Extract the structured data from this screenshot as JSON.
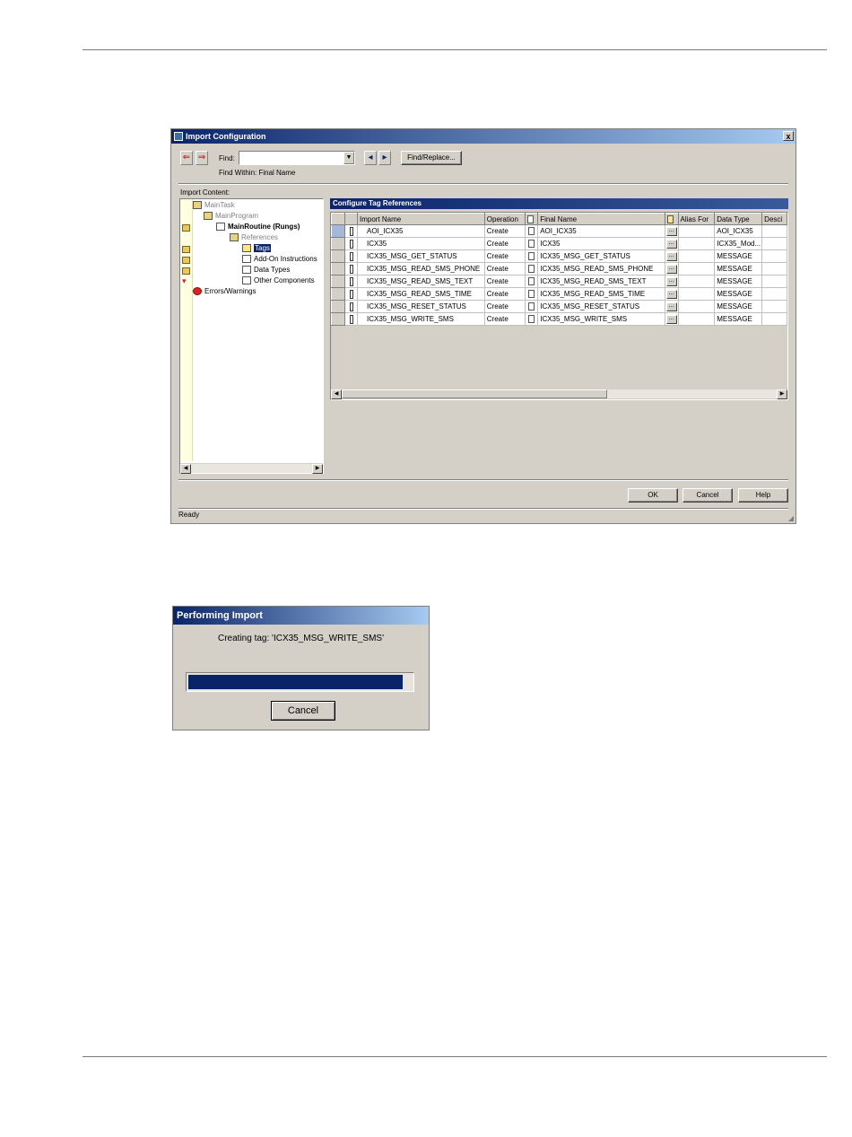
{
  "window": {
    "title": "Import Configuration",
    "close_label": "x",
    "find_label": "Find:",
    "find_value": "",
    "find_within": "Find Within: Final Name",
    "find_replace_label": "Find/Replace...",
    "import_content_label": "Import Content:",
    "status": "Ready"
  },
  "tree": {
    "items": [
      {
        "label": "MainTask"
      },
      {
        "label": "MainProgram"
      },
      {
        "label": "MainRoutine (Rungs)"
      },
      {
        "label": "References"
      },
      {
        "label": "Tags"
      },
      {
        "label": "Add-On Instructions"
      },
      {
        "label": "Data Types"
      },
      {
        "label": "Other Components"
      },
      {
        "label": "Errors/Warnings"
      }
    ]
  },
  "grid": {
    "title": "Configure Tag References",
    "columns": [
      "Import Name",
      "Operation",
      "Final Name",
      "Alias For",
      "Data Type",
      "Desci"
    ],
    "rows": [
      {
        "import_name": "AOI_ICX35",
        "operation": "Create",
        "final_name": "AOI_ICX35",
        "alias": "",
        "data_type": "AOI_ICX35"
      },
      {
        "import_name": "ICX35",
        "operation": "Create",
        "final_name": "ICX35",
        "alias": "",
        "data_type": "ICX35_Mod..."
      },
      {
        "import_name": "ICX35_MSG_GET_STATUS",
        "operation": "Create",
        "final_name": "ICX35_MSG_GET_STATUS",
        "alias": "",
        "data_type": "MESSAGE"
      },
      {
        "import_name": "ICX35_MSG_READ_SMS_PHONE",
        "operation": "Create",
        "final_name": "ICX35_MSG_READ_SMS_PHONE",
        "alias": "",
        "data_type": "MESSAGE"
      },
      {
        "import_name": "ICX35_MSG_READ_SMS_TEXT",
        "operation": "Create",
        "final_name": "ICX35_MSG_READ_SMS_TEXT",
        "alias": "",
        "data_type": "MESSAGE"
      },
      {
        "import_name": "ICX35_MSG_READ_SMS_TIME",
        "operation": "Create",
        "final_name": "ICX35_MSG_READ_SMS_TIME",
        "alias": "",
        "data_type": "MESSAGE"
      },
      {
        "import_name": "ICX35_MSG_RESET_STATUS",
        "operation": "Create",
        "final_name": "ICX35_MSG_RESET_STATUS",
        "alias": "",
        "data_type": "MESSAGE"
      },
      {
        "import_name": "ICX35_MSG_WRITE_SMS",
        "operation": "Create",
        "final_name": "ICX35_MSG_WRITE_SMS",
        "alias": "",
        "data_type": "MESSAGE"
      }
    ]
  },
  "buttons": {
    "ok": "OK",
    "cancel": "Cancel",
    "help": "Help"
  },
  "progress_dialog": {
    "title": "Performing Import",
    "message": "Creating tag: 'ICX35_MSG_WRITE_SMS'",
    "progress": 0.96,
    "cancel": "Cancel"
  },
  "colors": {
    "title_blue": "#0a246a",
    "dialog_gray": "#d4d0c8"
  }
}
